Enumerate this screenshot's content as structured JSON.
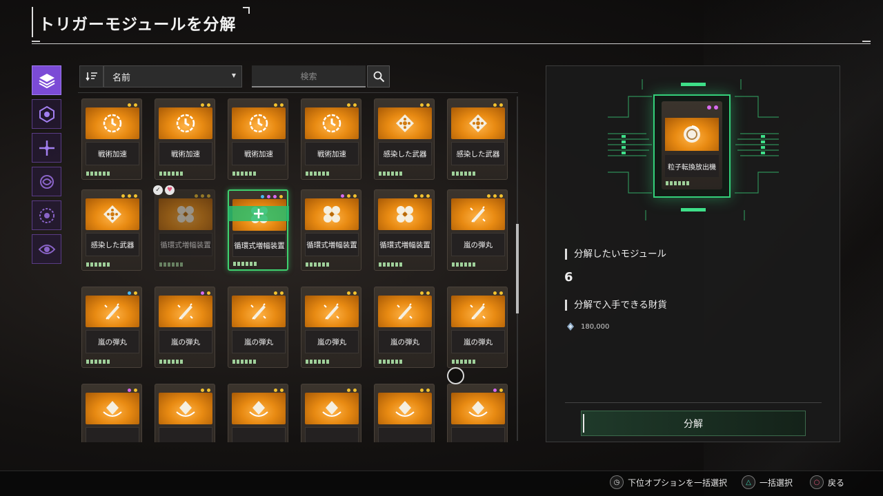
{
  "header": {
    "title": "トリガーモジュールを分解"
  },
  "toolbar": {
    "sort_value": "名前",
    "search_placeholder": "検索"
  },
  "tabs": [
    {
      "icon": "layers-icon",
      "active": true
    },
    {
      "icon": "hex-emblem-icon",
      "active": false
    },
    {
      "icon": "crosshair-icon",
      "active": false
    },
    {
      "icon": "swirl-icon",
      "active": false
    },
    {
      "icon": "burst-icon",
      "active": false
    },
    {
      "icon": "eye-icon",
      "active": false
    }
  ],
  "modules": [
    {
      "name": "戦術加速",
      "icon": "clock-icon",
      "dots": [
        "#f2c230",
        "#f2c230"
      ]
    },
    {
      "name": "戦術加速",
      "icon": "clock-icon",
      "dots": [
        "#f2c230",
        "#f2c230"
      ]
    },
    {
      "name": "戦術加速",
      "icon": "clock-icon",
      "dots": [
        "#f2c230",
        "#f2c230"
      ]
    },
    {
      "name": "戦術加速",
      "icon": "clock-icon",
      "dots": [
        "#f2c230",
        "#f2c230"
      ]
    },
    {
      "name": "感染した武器",
      "icon": "diamond-icon",
      "dots": [
        "#f2c230",
        "#f2c230"
      ]
    },
    {
      "name": "感染した武器",
      "icon": "diamond-icon",
      "dots": [
        "#f2c230",
        "#f2c230"
      ]
    },
    {
      "name": "感染した武器",
      "icon": "diamond-icon",
      "dots": [
        "#f2c230",
        "#f2c230",
        "#f2c230"
      ]
    },
    {
      "name": "循環式増幅装置",
      "icon": "cluster-icon",
      "dots": [
        "#f2c230",
        "#f2c230",
        "#f2c230"
      ],
      "dim": true
    },
    {
      "name": "循環式増幅装置",
      "icon": "cluster-icon",
      "dots": [
        "#4ab8f0",
        "#d86bf0",
        "#d86bf0",
        "#f2c230"
      ],
      "selected": true
    },
    {
      "name": "循環式増幅装置",
      "icon": "cluster-icon",
      "dots": [
        "#d86bf0",
        "#f2c230",
        "#f2c230"
      ]
    },
    {
      "name": "循環式増幅装置",
      "icon": "cluster-icon",
      "dots": [
        "#f2c230",
        "#f2c230",
        "#f2c230"
      ]
    },
    {
      "name": "嵐の弾丸",
      "icon": "bullet-icon",
      "dots": [
        "#f2c230",
        "#f2c230",
        "#f2c230"
      ]
    },
    {
      "name": "嵐の弾丸",
      "icon": "bullet-icon",
      "dots": [
        "#4ab8f0",
        "#f2c230"
      ]
    },
    {
      "name": "嵐の弾丸",
      "icon": "bullet-icon",
      "dots": [
        "#d86bf0",
        "#f2c230"
      ]
    },
    {
      "name": "嵐の弾丸",
      "icon": "bullet-icon",
      "dots": [
        "#f2c230",
        "#f2c230"
      ]
    },
    {
      "name": "嵐の弾丸",
      "icon": "bullet-icon",
      "dots": [
        "#f2c230",
        "#f2c230"
      ]
    },
    {
      "name": "嵐の弾丸",
      "icon": "bullet-icon",
      "dots": [
        "#f2c230",
        "#f2c230"
      ]
    },
    {
      "name": "嵐の弾丸",
      "icon": "bullet-icon",
      "dots": [
        "#f2c230",
        "#f2c230"
      ]
    },
    {
      "name": "",
      "icon": "crown-icon",
      "dots": [
        "#d86bf0",
        "#f2c230"
      ]
    },
    {
      "name": "",
      "icon": "crown-icon",
      "dots": [
        "#f2c230",
        "#f2c230"
      ]
    },
    {
      "name": "",
      "icon": "crown-icon",
      "dots": [
        "#f2c230",
        "#f2c230"
      ]
    },
    {
      "name": "",
      "icon": "crown-icon",
      "dots": [
        "#f2c230",
        "#f2c230"
      ]
    },
    {
      "name": "",
      "icon": "crown-icon",
      "dots": [
        "#f2c230",
        "#f2c230"
      ]
    },
    {
      "name": "",
      "icon": "crown-icon",
      "dots": [
        "#d86bf0",
        "#f2c230"
      ]
    }
  ],
  "preview": {
    "name": "粒子転換放出機",
    "dots": [
      "#d86bf0",
      "#d86bf0"
    ]
  },
  "details": {
    "modules_label": "分解したいモジュール",
    "modules_count": "6",
    "currency_label": "分解で入手できる財貨",
    "currency_amount": "180,000"
  },
  "action": {
    "disassemble_label": "分解"
  },
  "footer": {
    "bulk_lower_label": "下位オプションを一括選択",
    "bulk_select_label": "一括選択",
    "back_label": "戻る"
  },
  "colors": {
    "accent_green": "#34d07a",
    "accent_purple": "#7b4bd6",
    "card_orange": "#e88a12"
  }
}
